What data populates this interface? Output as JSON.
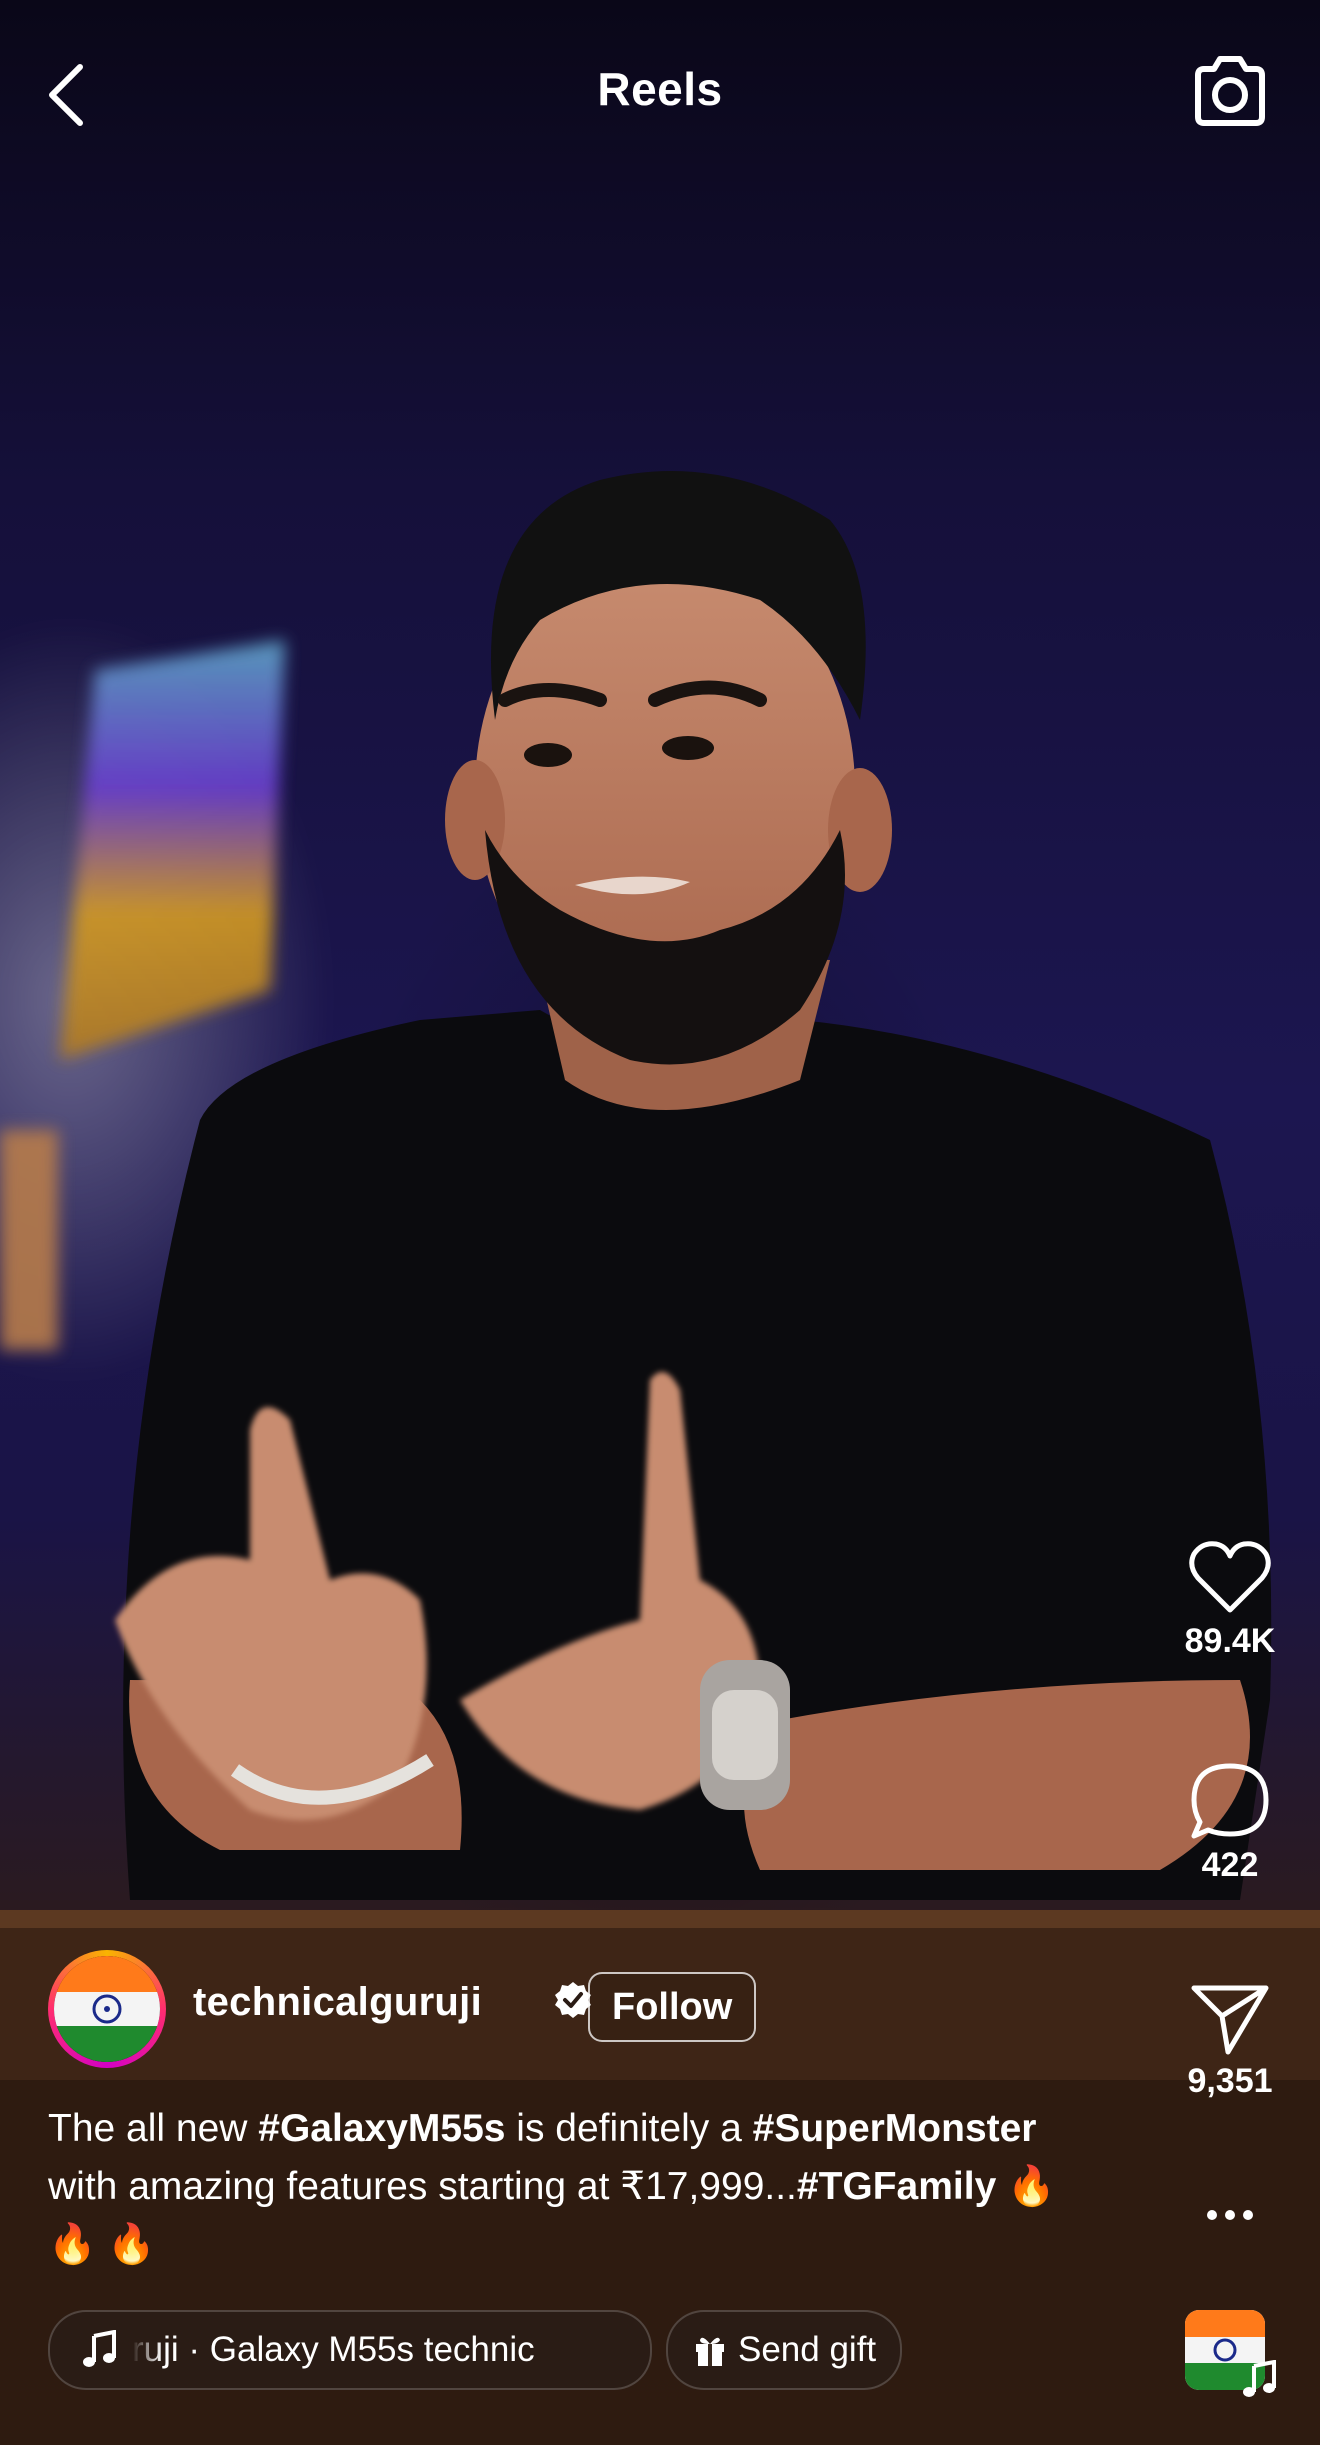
{
  "header": {
    "title": "Reels"
  },
  "actions": {
    "likes": "89.4K",
    "comments": "422",
    "shares": "9,351"
  },
  "post": {
    "username": "technicalguruji",
    "follow_label": "Follow",
    "caption": {
      "part1": "The all new ",
      "tag1": "#GalaxyM55s",
      "part2": " is definitely a ",
      "tag2": "#SuperMonster",
      "part3": " with amazing features starting at ₹17,999...",
      "tag3": "#TGFamily",
      "emoji": " 🔥 🔥 🔥"
    }
  },
  "audio": {
    "track": "ruji · Galaxy M55s     technic"
  },
  "gift": {
    "label": "Send gift"
  },
  "icons": {
    "back": "chevron-left-icon",
    "camera": "camera-icon",
    "like": "heart-icon",
    "comment": "comment-bubble-icon",
    "share": "paper-plane-icon",
    "more": "more-horizontal-icon",
    "verified": "verified-badge-icon",
    "music": "music-note-icon",
    "gift": "gift-icon"
  },
  "colors": {
    "background": "#15103a",
    "accent_ring": "#ff2d6f",
    "text": "#ffffff"
  }
}
